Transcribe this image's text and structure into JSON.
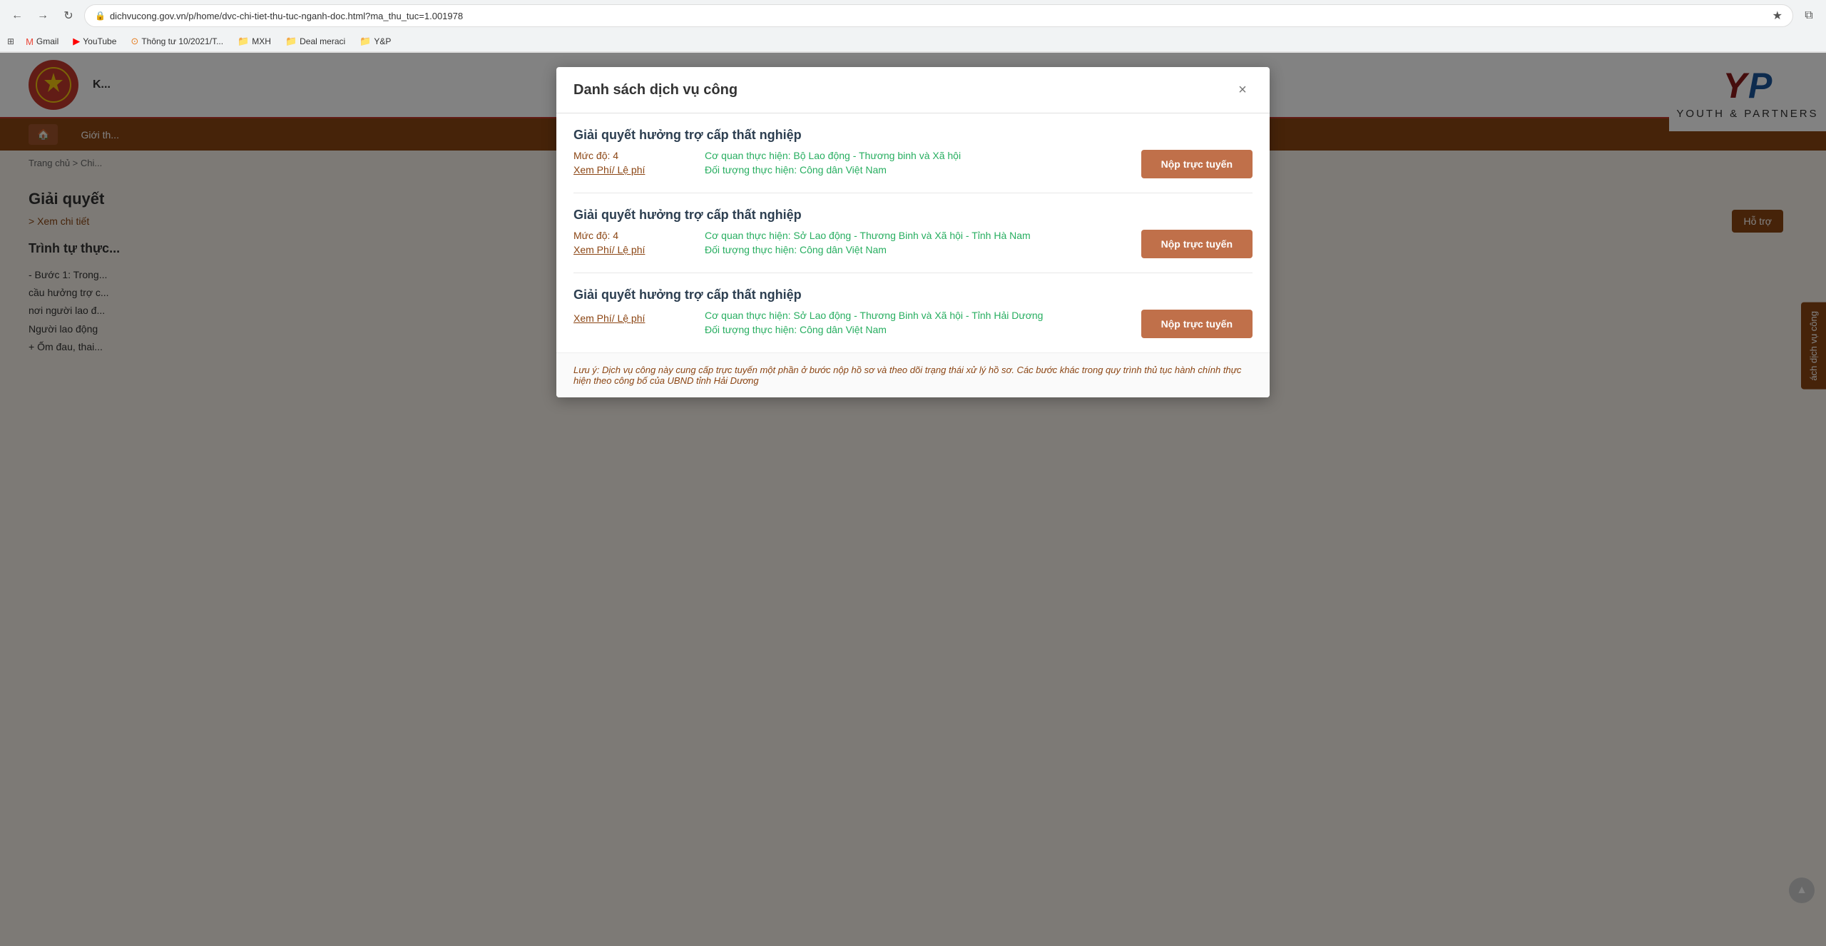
{
  "browser": {
    "back_btn": "←",
    "forward_btn": "→",
    "reload_btn": "↻",
    "address": "dichvucong.gov.vn/p/home/dvc-chi-tiet-thu-tuc-nganh-doc.html?ma_thu_tuc=1.001978",
    "star_icon": "★",
    "bookmarks": [
      {
        "label": "Gmail",
        "icon": "M",
        "type": "gmail"
      },
      {
        "label": "YouTube",
        "icon": "▶",
        "type": "youtube"
      },
      {
        "label": "Thông tư 10/2021/T...",
        "icon": "⊙",
        "type": "thongtu"
      },
      {
        "label": "MXH",
        "icon": "📁",
        "type": "folder"
      },
      {
        "label": "Deal meraci",
        "icon": "📁",
        "type": "folder"
      },
      {
        "label": "Y&P",
        "icon": "📁",
        "type": "folder"
      }
    ]
  },
  "bg_page": {
    "nav_items": [
      "Giới th...",
      "Hỗ trợ"
    ],
    "breadcrumb": "Trang chủ > Chi...",
    "main_title": "Giải quyết",
    "link_text": "> Xem chi tiết",
    "section_title": "Trình tự thực...",
    "content_lines": [
      "- Bước 1: Trong...",
      "cầu hưởng trợ c...",
      "nơi người lao đ...",
      "Người lao động",
      "+ Ốm đau, thai..."
    ]
  },
  "modal": {
    "title": "Danh sách dịch vụ công",
    "close_label": "×",
    "services": [
      {
        "id": "service-1",
        "title": "Giải quyết hưởng trợ cấp thất nghiệp",
        "level_label": "Mức độ: 4",
        "fee_label": "Xem Phí/ Lệ phí",
        "org": "Cơ quan thực hiện: Bộ Lao động - Thương binh và Xã hội",
        "target": "Đối tượng thực hiện: Công dân Việt Nam",
        "btn_label": "Nộp trực tuyến"
      },
      {
        "id": "service-2",
        "title": "Giải quyết hưởng trợ cấp thất nghiệp",
        "level_label": "Mức độ: 4",
        "fee_label": "Xem Phí/ Lệ phí",
        "org": "Cơ quan thực hiện: Sở Lao động - Thương Binh và Xã hội - Tỉnh Hà Nam",
        "target": "Đối tượng thực hiện: Công dân Việt Nam",
        "btn_label": "Nộp trực tuyến"
      },
      {
        "id": "service-3",
        "title": "Giải quyết hưởng trợ cấp thất nghiệp",
        "level_label": "",
        "fee_label": "Xem Phí/ Lệ phí",
        "org": "Cơ quan thực hiện: Sở Lao động - Thương Binh và Xã hội - Tỉnh Hải Dương",
        "target": "Đối tượng thực hiện: Công dân Việt Nam",
        "btn_label": "Nộp trực tuyến"
      }
    ],
    "note": "Lưu ý: Dịch vụ công này cung cấp trực tuyến một phần ở bước nộp hồ sơ và theo dõi trạng thái xử lý hồ sơ. Các bước khác trong quy trình thủ tục hành chính thực hiện theo công bố của UBND tỉnh Hải Dương"
  },
  "yp": {
    "y_letter": "Y",
    "p_letter": "P",
    "brand_line": "YOUTH & PARTNERS"
  },
  "sidebar": {
    "hotro_label": "Hỗ trợ",
    "dvc_label": "ách dịch vụ công",
    "scroll_up": "▲"
  }
}
